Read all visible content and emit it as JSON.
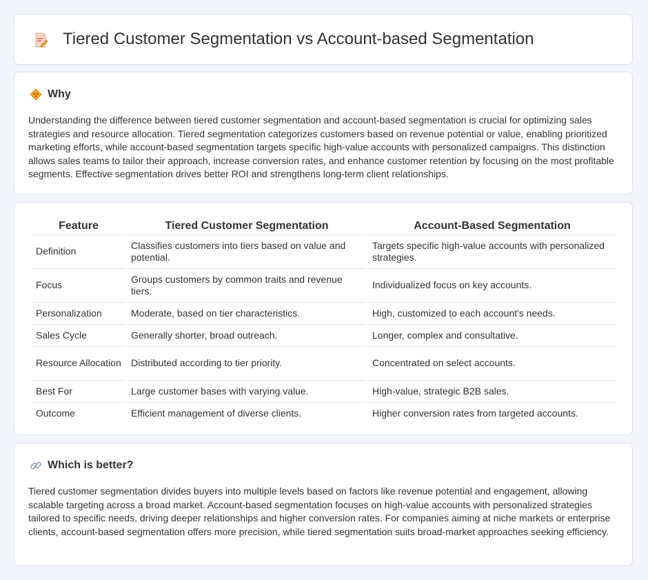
{
  "page": {
    "title": "Tiered Customer Segmentation vs Account-based Segmentation",
    "title_icon": "document-edit-icon"
  },
  "why": {
    "icon": "diamond-warning-icon",
    "heading": "Why",
    "body": "Understanding the difference between tiered customer segmentation and account-based segmentation is crucial for optimizing sales strategies and resource allocation. Tiered segmentation categorizes customers based on revenue potential or value, enabling prioritized marketing efforts, while account-based segmentation targets specific high-value accounts with personalized campaigns. This distinction allows sales teams to tailor their approach, increase conversion rates, and enhance customer retention by focusing on the most profitable segments. Effective segmentation drives better ROI and strengthens long-term client relationships."
  },
  "table": {
    "headers": [
      "Feature",
      "Tiered Customer Segmentation",
      "Account-Based Segmentation"
    ],
    "rows": [
      [
        "Definition",
        "Classifies customers into tiers based on value and potential.",
        "Targets specific high-value accounts with personalized strategies."
      ],
      [
        "Focus",
        "Groups customers by common traits and revenue tiers.",
        "Individualized focus on key accounts."
      ],
      [
        "Personalization",
        "Moderate, based on tier characteristics.",
        "High, customized to each account's needs."
      ],
      [
        "Sales Cycle",
        "Generally shorter, broad outreach.",
        "Longer, complex and consultative."
      ],
      [
        "Resource Allocation",
        "Distributed according to tier priority.",
        "Concentrated on select accounts."
      ],
      [
        "Best For",
        "Large customer bases with varying value.",
        "High-value, strategic B2B sales."
      ],
      [
        "Outcome",
        "Efficient management of diverse clients.",
        "Higher conversion rates from targeted accounts."
      ]
    ]
  },
  "better": {
    "icon": "link-icon",
    "heading": "Which is better?",
    "body": "Tiered customer segmentation divides buyers into multiple levels based on factors like revenue potential and engagement, allowing scalable targeting across a broad market. Account-based segmentation focuses on high-value accounts with personalized strategies tailored to specific needs, driving deeper relationships and higher conversion rates. For companies aiming at niche markets or enterprise clients, account-based segmentation offers more precision, while tiered segmentation suits broad-market approaches seeking efficiency."
  },
  "colors": {
    "background": "#f3f5fa",
    "card": "#ffffff",
    "text": "#333333",
    "icon_orange": "#f0a030",
    "icon_pink": "#e86a6a"
  }
}
